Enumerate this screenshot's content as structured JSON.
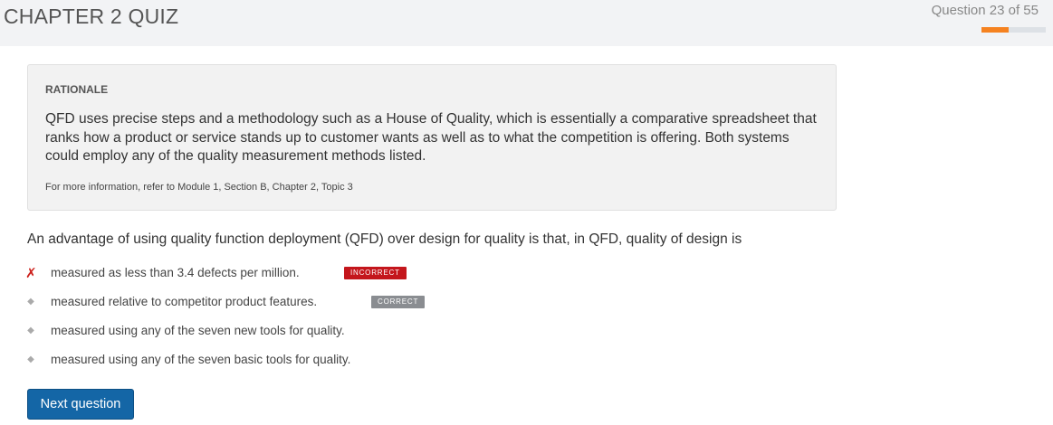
{
  "header": {
    "title": "CHAPTER 2 QUIZ",
    "progress_text": "Question 23 of 55",
    "progress_fraction": 0.418,
    "progress_color": "#f58220"
  },
  "rationale": {
    "heading": "RATIONALE",
    "text": "QFD uses precise steps and a methodology such as a House of Quality, which is essentially a comparative spreadsheet that ranks how a product or service stands up to customer wants as well as to what the competition is offering. Both systems could employ any of the quality measurement methods listed.",
    "reference": "For more information, refer to Module 1, Section B, Chapter 2, Topic 3"
  },
  "question": {
    "text": "An advantage of using quality function deployment (QFD) over design for quality is that, in QFD, quality of design is"
  },
  "answers": [
    {
      "text": "measured as less than 3.4 defects per million.",
      "marker": "✗",
      "badge": "INCORRECT"
    },
    {
      "text": "measured relative to competitor product features.",
      "marker": "◆",
      "badge": "CORRECT"
    },
    {
      "text": "measured using any of the seven new tools for quality.",
      "marker": "◆"
    },
    {
      "text": "measured using any of the seven basic tools for quality.",
      "marker": "◆"
    }
  ],
  "actions": {
    "next_label": "Next question"
  },
  "colors": {
    "incorrect": "#c4161c",
    "correct": "#8a8d91",
    "primary_button": "#1466a6"
  }
}
